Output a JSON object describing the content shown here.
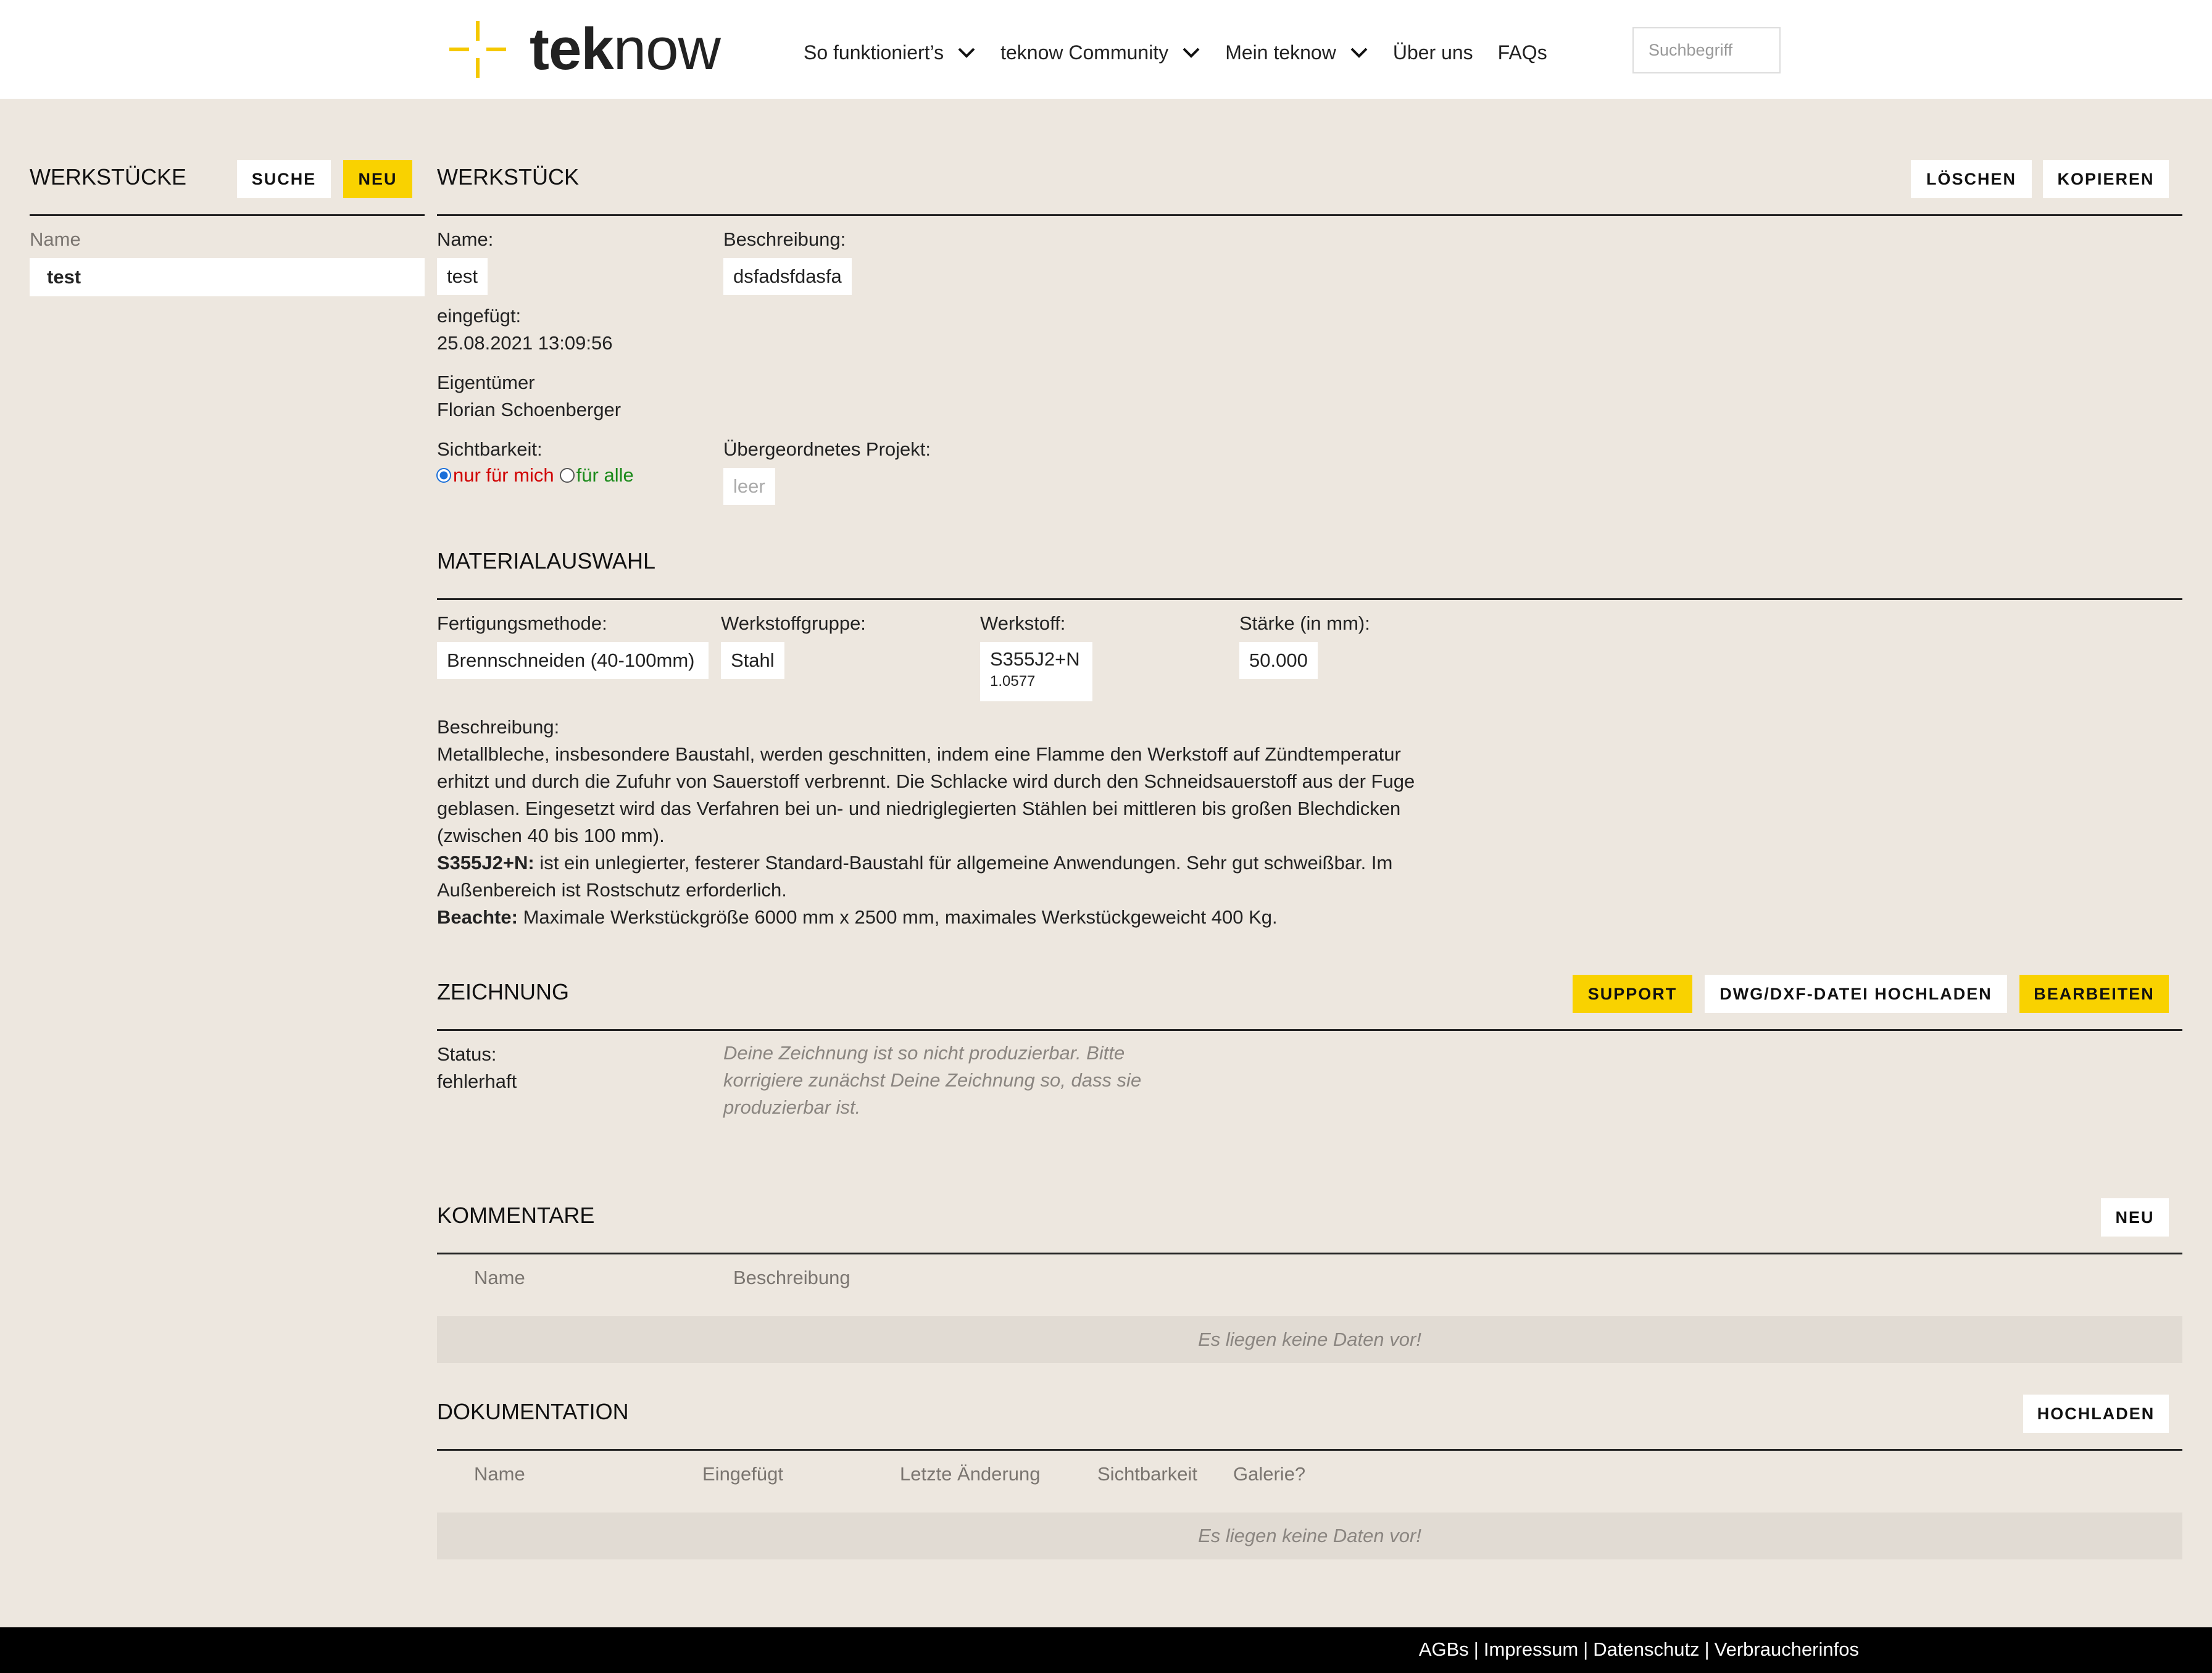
{
  "header": {
    "logo_bold": "tek",
    "logo_light": "now",
    "nav": [
      {
        "label": "So funktioniert’s",
        "has_dropdown": true
      },
      {
        "label": "teknow Community",
        "has_dropdown": true
      },
      {
        "label": "Mein teknow",
        "has_dropdown": true
      },
      {
        "label": "Über uns",
        "has_dropdown": false
      },
      {
        "label": "FAQs",
        "has_dropdown": false
      }
    ],
    "search_placeholder": "Suchbegriff"
  },
  "sidebar": {
    "title": "WERKSTÜCKE",
    "search_button": "SUCHE",
    "new_button": "NEU",
    "column_header": "Name",
    "items": [
      "test"
    ]
  },
  "workpiece": {
    "title": "WERKSTÜCK",
    "delete_button": "LÖSCHEN",
    "copy_button": "KOPIEREN",
    "name_label": "Name:",
    "name_value": "test",
    "description_label": "Beschreibung:",
    "description_value": "dsfadsfdasfa",
    "inserted_label": "eingefügt:",
    "inserted_value": "25.08.2021 13:09:56",
    "owner_label": "Eigentümer",
    "owner_value": "Florian Schoenberger",
    "visibility_label": "Sichtbarkeit:",
    "visibility_options": [
      "nur für mich",
      "für alle"
    ],
    "visibility_selected": "nur für mich",
    "parent_project_label": "Übergeordnetes Projekt:",
    "parent_project_value": "leer"
  },
  "material": {
    "title": "MATERIALAUSWAHL",
    "method_label": "Fertigungsmethode:",
    "method_value": "Brennschneiden (40-100mm)",
    "group_label": "Werkstoffgruppe:",
    "group_value": "Stahl",
    "material_label": "Werkstoff:",
    "material_value": "S355J2+N",
    "material_number": "1.0577",
    "thickness_label": "Stärke (in mm):",
    "thickness_value": "50.000",
    "desc_label": "Beschreibung:",
    "desc_text": "Metallbleche, insbesondere Baustahl, werden geschnitten, indem eine Flamme den Werkstoff auf Zündtemperatur erhitzt und durch die Zufuhr von Sauerstoff verbrennt. Die Schlacke wird durch den Schneidsauerstoff aus der Fuge geblasen. Eingesetzt wird das Verfahren bei un- und niedriglegierten Stählen bei mittleren bis großen Blechdicken (zwischen 40 bis 100 mm).",
    "steel_name": "S355J2+N:",
    "steel_text": "ist ein unlegierter, festerer Standard-Baustahl für allgemeine Anwendungen. Sehr gut schweißbar. Im Außenbereich ist Rostschutz erforderlich.",
    "note_label": "Beachte:",
    "note_text": "Maximale Werkstückgröße 6000 mm x 2500 mm, maximales Werkstückgeweicht 400 Kg."
  },
  "drawing": {
    "title": "ZEICHNUNG",
    "support_button": "SUPPORT",
    "upload_button": "DWG/DXF-DATEI HOCHLADEN",
    "edit_button": "BEARBEITEN",
    "status_label": "Status:",
    "status_value": "fehlerhaft",
    "status_message": "Deine Zeichnung ist so nicht produzierbar. Bitte korrigiere zunächst Deine Zeichnung so, dass sie produzierbar ist."
  },
  "comments": {
    "title": "KOMMENTARE",
    "new_button": "NEU",
    "columns": [
      "Name",
      "Beschreibung"
    ],
    "empty_text": "Es liegen keine Daten vor!"
  },
  "documentation": {
    "title": "DOKUMENTATION",
    "upload_button": "HOCHLADEN",
    "columns": [
      "Name",
      "Eingefügt",
      "Letzte Änderung",
      "Sichtbarkeit",
      "Galerie?"
    ],
    "empty_text": "Es liegen keine Daten vor!"
  },
  "footer": {
    "links": [
      "AGBs",
      "Impressum",
      "Datenschutz",
      "Verbraucherinfos"
    ],
    "separator": "|"
  },
  "colors": {
    "accent_yellow": "#f9d200",
    "background": "#ede7df",
    "visibility_private": "#d00000",
    "visibility_public": "#1a8a1a"
  },
  "icons": {
    "logo": "crosshair-logo-icon",
    "dropdown": "chevron-down-icon"
  }
}
